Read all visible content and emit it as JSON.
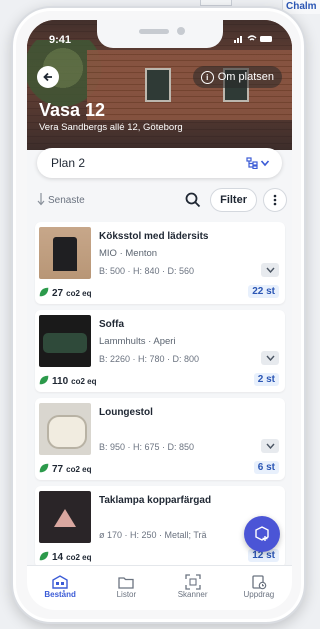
{
  "background": {
    "tab_label": "Chalm"
  },
  "status_bar": {
    "time": "9:41"
  },
  "header": {
    "about_label": "Om platsen",
    "title": "Vasa 12",
    "address": "Vera Sandbergs allé 12, Göteborg"
  },
  "plan_select": {
    "value": "Plan 2"
  },
  "toolbar": {
    "sort_label": "Senaste",
    "filter_label": "Filter"
  },
  "items": [
    {
      "name": "Köksstol med lädersits",
      "brand": "MIO · Menton",
      "dims": "B: 500 · H: 840 · D: 560",
      "co2": "27",
      "co2_unit": "co2 eq",
      "qty": "22 st",
      "thumb": "chair"
    },
    {
      "name": "Soffa",
      "brand": "Lammhults · Aperi",
      "dims": "B: 2260 · H: 780 · D: 800",
      "co2": "110",
      "co2_unit": "co2 eq",
      "qty": "2 st",
      "thumb": "sofa"
    },
    {
      "name": "Loungestol",
      "brand": "",
      "dims": "B: 950 · H: 675 · D: 850",
      "co2": "77",
      "co2_unit": "co2 eq",
      "qty": "6 st",
      "thumb": "lounge"
    },
    {
      "name": "Taklampa kopparfärgad",
      "brand": "",
      "dims": "ø 170 · H: 250 · Metall; Trä",
      "co2": "14",
      "co2_unit": "co2 eq",
      "qty": "12 st",
      "thumb": "lamp"
    }
  ],
  "tabs": [
    {
      "label": "Bestånd",
      "icon": "inventory-icon",
      "active": true
    },
    {
      "label": "Listor",
      "icon": "folder-icon",
      "active": false
    },
    {
      "label": "Skanner",
      "icon": "scanner-icon",
      "active": false
    },
    {
      "label": "Uppdrag",
      "icon": "assignment-icon",
      "active": false
    }
  ],
  "colors": {
    "accent": "#3b5bd6",
    "fab": "#4b55d6",
    "co2_leaf": "#2c9a4b"
  }
}
